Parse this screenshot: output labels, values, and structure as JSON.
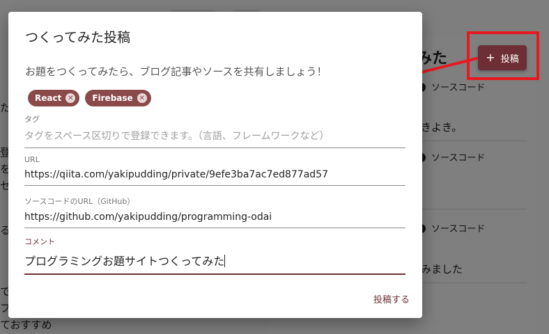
{
  "background": {
    "heading_fragment": "みた",
    "source_code_label": "ソースコード",
    "text_1": "きよき。",
    "text_2": "みました",
    "left_fragments": [
      "た",
      "登",
      "を",
      "セ",
      "る",
      "で",
      "フ",
      "ておすすめ"
    ],
    "post_button": {
      "label": "投稿",
      "icon": "plus-icon"
    }
  },
  "dialog": {
    "title": "つくってみた投稿",
    "description": "お題をつくってみたら、ブログ記事やソースを共有しましょう！",
    "tags": [
      {
        "label": "React",
        "remove_icon": "close-circle-icon"
      },
      {
        "label": "Firebase",
        "remove_icon": "close-circle-icon"
      }
    ],
    "fields": {
      "tag": {
        "label": "タグ",
        "placeholder": "タグをスペース区切りで登録できます。（言語、フレームワークなど）"
      },
      "url": {
        "label": "URL",
        "value": "https://qiita.com/yakipudding/private/9efe3ba7ac7ed877ad57"
      },
      "source_url": {
        "label": "ソースコードのURL（GitHub）",
        "value": "https://github.com/yakipudding/programming-odai"
      },
      "comment": {
        "label": "コメント",
        "value": "プログラミングお題サイトつくってみた"
      }
    },
    "submit_label": "投稿する"
  },
  "colors": {
    "accent": "#6d2f35",
    "chip": "#8a4a4a",
    "annotation_red": "#e8181f"
  }
}
